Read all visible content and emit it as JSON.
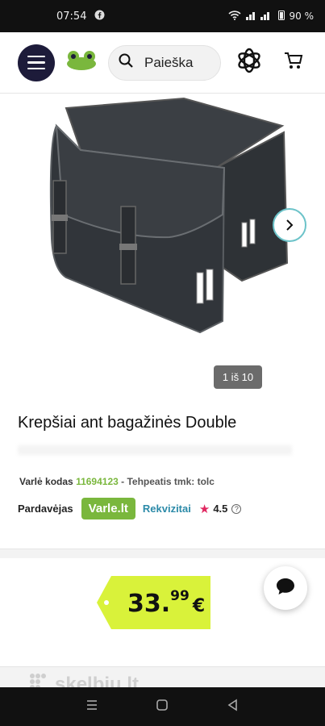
{
  "status_bar": {
    "time": "07:54",
    "battery": "90 %"
  },
  "header": {
    "search_label": "Paieška"
  },
  "gallery": {
    "counter": "1 iš 10"
  },
  "product": {
    "title": "Krepšiai ant bagažinės Double",
    "code_label": "Varlė kodas",
    "code_value": "11694123",
    "code_after": "- Tehpeatis tmk: tolc"
  },
  "seller": {
    "label": "Pardavėjas",
    "name": "Varle.lt",
    "details_link": "Rekvizitai",
    "rating": "4.5"
  },
  "price": {
    "integer": "33",
    "cents": "99",
    "currency": "€"
  },
  "watermark": "skelbiu.lt",
  "colors": {
    "brand_green": "#7ab73d",
    "price_yellow": "#d9f23a",
    "menu_navy": "#1d1b3a",
    "link_teal": "#2b8aa8",
    "star_pink": "#e02760"
  }
}
